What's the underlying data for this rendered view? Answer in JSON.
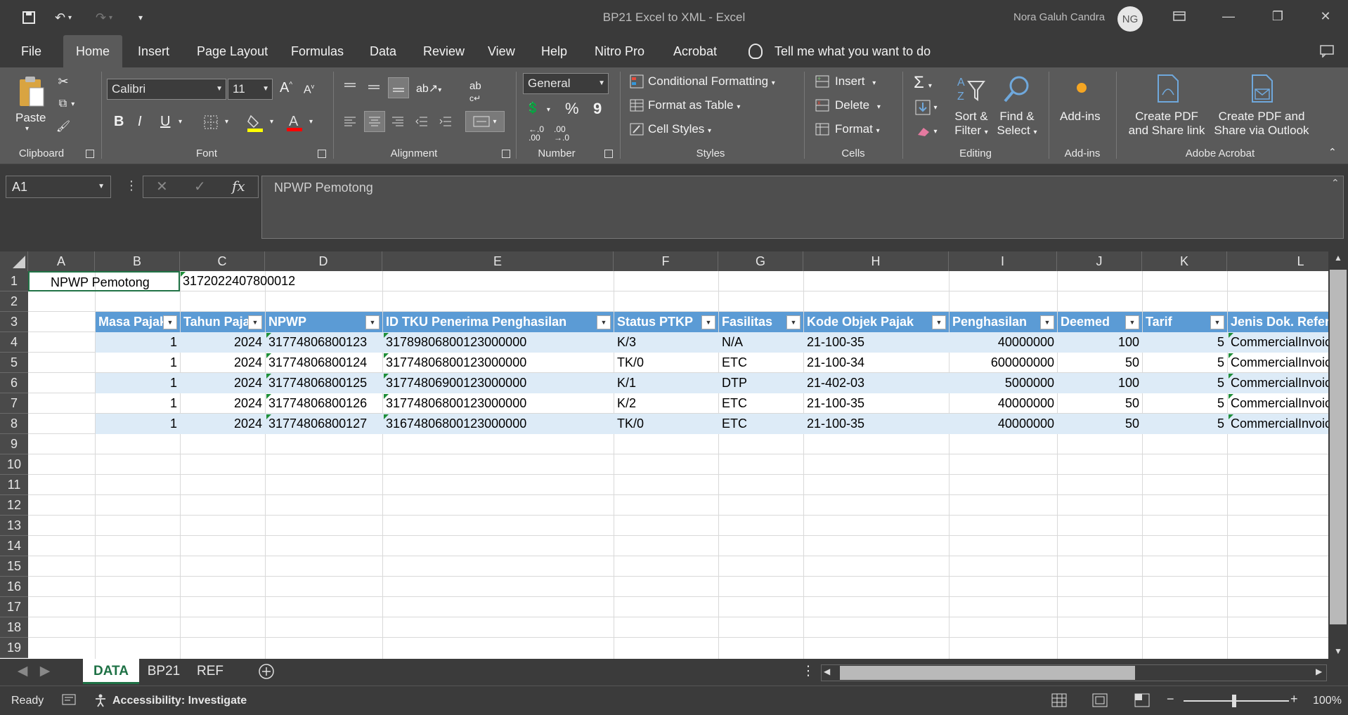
{
  "titlebar": {
    "title": "BP21 Excel to XML  -  Excel",
    "user": "Nora Galuh Candra",
    "avatar": "NG"
  },
  "menu": {
    "tabs": [
      "File",
      "Home",
      "Insert",
      "Page Layout",
      "Formulas",
      "Data",
      "Review",
      "View",
      "Help",
      "Nitro Pro",
      "Acrobat"
    ],
    "active": "Home",
    "tell_me": "Tell me what you want to do"
  },
  "ribbon": {
    "clipboard": {
      "paste": "Paste",
      "label": "Clipboard"
    },
    "font": {
      "name": "Calibri",
      "size": "11",
      "label": "Font",
      "bold": "B",
      "italic": "I",
      "underline": "U"
    },
    "alignment": {
      "label": "Alignment"
    },
    "number": {
      "format": "General",
      "percent": "%",
      "comma": "9",
      "label": "Number"
    },
    "styles": {
      "conditional": "Conditional Formatting",
      "format_table": "Format as Table",
      "cell_styles": "Cell Styles",
      "label": "Styles"
    },
    "cells": {
      "insert": "Insert",
      "delete": "Delete",
      "format": "Format",
      "label": "Cells"
    },
    "editing": {
      "sort": "Sort &",
      "filter": "Filter",
      "find": "Find &",
      "select": "Select",
      "label": "Editing"
    },
    "addins": {
      "button": "Add-ins",
      "label": "Add-ins"
    },
    "acrobat": {
      "create_link_1": "Create PDF",
      "create_link_2": "and Share link",
      "create_outlook_1": "Create PDF and",
      "create_outlook_2": "Share via Outlook",
      "label": "Adobe Acrobat"
    }
  },
  "formula_bar": {
    "name_box": "A1",
    "formula": "NPWP Pemotong"
  },
  "columns": [
    "A",
    "B",
    "C",
    "D",
    "E",
    "F",
    "G",
    "H",
    "I",
    "J",
    "K",
    "L"
  ],
  "rows": [
    "1",
    "2",
    "3",
    "4",
    "5",
    "6",
    "7",
    "8",
    "9",
    "10",
    "11",
    "12",
    "13",
    "14",
    "15",
    "16",
    "17",
    "18",
    "19"
  ],
  "sheet": {
    "a1": "NPWP Pemotong",
    "c1": "3172022407800012",
    "headers": [
      "Masa Pajak",
      "Tahun Pajak",
      "NPWP",
      "ID TKU Penerima Penghasilan",
      "Status PTKP",
      "Fasilitas",
      "Kode Objek Pajak",
      "Penghasilan",
      "Deemed",
      "Tarif",
      "Jenis Dok. Referensi"
    ],
    "data": [
      [
        "1",
        "2024",
        "31774806800123",
        "31789806800123000000",
        "K/3",
        "N/A",
        "21-100-35",
        "40000000",
        "100",
        "5",
        "CommercialInvoice"
      ],
      [
        "1",
        "2024",
        "31774806800124",
        "31774806800123000000",
        "TK/0",
        "ETC",
        "21-100-34",
        "600000000",
        "50",
        "5",
        "CommercialInvoice"
      ],
      [
        "1",
        "2024",
        "31774806800125",
        "31774806900123000000",
        "K/1",
        "DTP",
        "21-402-03",
        "5000000",
        "100",
        "5",
        "CommercialInvoice"
      ],
      [
        "1",
        "2024",
        "31774806800126",
        "31774806800123000000",
        "K/2",
        "ETC",
        "21-100-35",
        "40000000",
        "50",
        "5",
        "CommercialInvoice"
      ],
      [
        "1",
        "2024",
        "31774806800127",
        "31674806800123000000",
        "TK/0",
        "ETC",
        "21-100-35",
        "40000000",
        "50",
        "5",
        "CommercialInvoice"
      ]
    ]
  },
  "sheet_tabs": [
    "DATA",
    "BP21",
    "REF"
  ],
  "status": {
    "ready": "Ready",
    "accessibility": "Accessibility: Investigate",
    "zoom": "100%"
  },
  "colors": {
    "table_header": "#5b9bd5",
    "band": "#ddebf7",
    "excel_green": "#1e7145"
  }
}
